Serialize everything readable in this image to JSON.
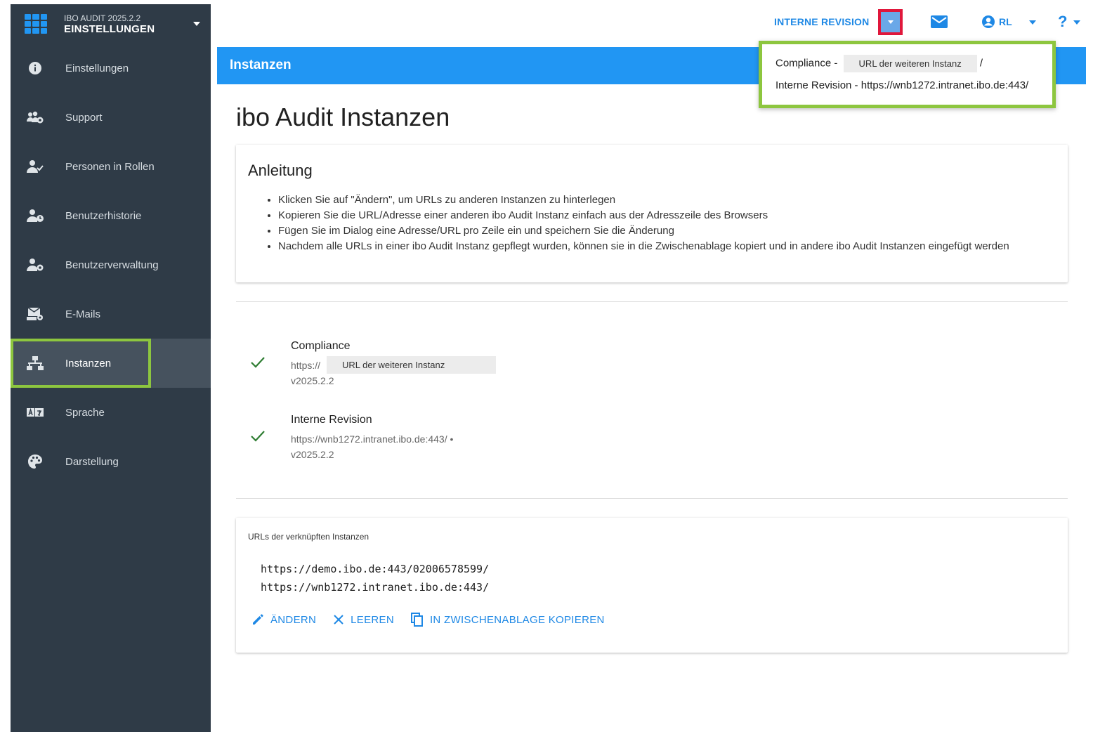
{
  "sidebar": {
    "app_version": "IBO AUDIT 2025.2.2",
    "section": "EINSTELLUNGEN",
    "items": [
      {
        "label": "Einstellungen",
        "icon": "info-icon"
      },
      {
        "label": "Support",
        "icon": "support-icon"
      },
      {
        "label": "Personen in Rollen",
        "icon": "person-check-icon"
      },
      {
        "label": "Benutzerhistorie",
        "icon": "user-history-icon"
      },
      {
        "label": "Benutzerverwaltung",
        "icon": "user-settings-icon"
      },
      {
        "label": "E-Mails",
        "icon": "email-settings-icon"
      },
      {
        "label": "Instanzen",
        "icon": "network-icon",
        "active": true
      },
      {
        "label": "Sprache",
        "icon": "translate-icon"
      },
      {
        "label": "Darstellung",
        "icon": "palette-icon"
      }
    ]
  },
  "topbar": {
    "instance_label": "INTERNE REVISION",
    "user_initials": "RL",
    "help_label": "?"
  },
  "header": {
    "title": "Instanzen"
  },
  "dropdown": {
    "row1_prefix": "Compliance -",
    "row1_mask": "URL der weiteren Instanz",
    "row1_suffix": "/",
    "row2": "Interne Revision - https://wnb1272.intranet.ibo.de:443/"
  },
  "main": {
    "page_title": "ibo Audit Instanzen",
    "guide": {
      "heading": "Anleitung",
      "bullets": [
        "Klicken Sie auf \"Ändern\", um URLs zu anderen Instanzen zu hinterlegen",
        "Kopieren Sie die URL/Adresse einer anderen ibo Audit Instanz einfach aus der Adresszeile des Browsers",
        "Fügen Sie im Dialog eine Adresse/URL pro Zeile ein und speichern Sie die Änderung",
        "Nachdem alle URLs in einer ibo Audit Instanz gepflegt wurden, können sie in die Zwischenablage kopiert und in andere ibo Audit Instanzen eingefügt werden"
      ]
    },
    "instances": [
      {
        "name": "Compliance",
        "url": "https://",
        "mask": "URL der weiteren Instanz",
        "version": "v2025.2.2"
      },
      {
        "name": "Interne Revision",
        "url": "https://wnb1272.intranet.ibo.de:443/ •",
        "version": "v2025.2.2"
      }
    ],
    "urls_card": {
      "label": "URLs der verknüpften Instanzen",
      "lines": [
        "https://demo.ibo.de:443/02006578599/",
        "https://wnb1272.intranet.ibo.de:443/"
      ],
      "actions": {
        "edit": "ÄNDERN",
        "clear": "LEEREN",
        "copy": "IN ZWISCHENABLAGE KOPIEREN"
      }
    }
  },
  "colors": {
    "sidebar_bg": "#2f3b47",
    "accent": "#2196f3",
    "highlight": "#8dc63f",
    "alert": "#e0173b",
    "success": "#2e7d32"
  }
}
